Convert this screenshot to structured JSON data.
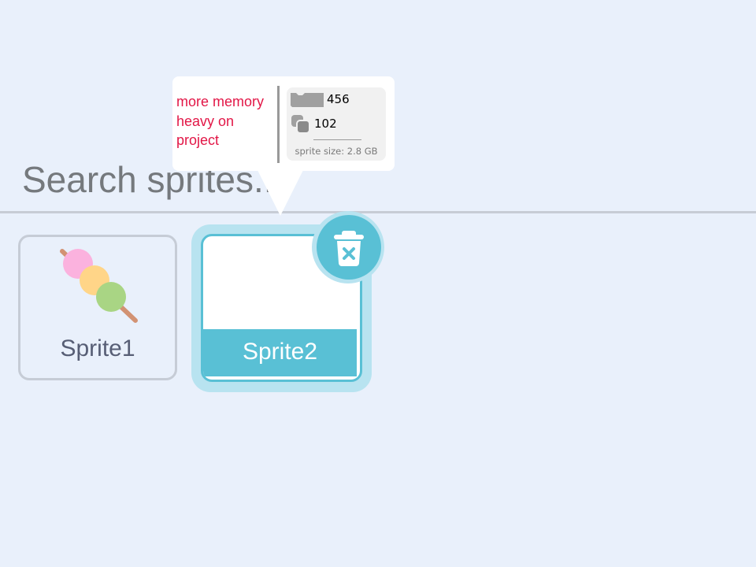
{
  "search": {
    "placeholder": "Search sprites..."
  },
  "tooltip": {
    "note": "more memory heavy on project",
    "stats": {
      "blocks_icon": "block-icon",
      "blocks_count": "456",
      "costumes_icon": "costumes-icon",
      "costumes_count": "102",
      "sprite_size": "sprite size: 2.8 GB"
    }
  },
  "sprites": [
    {
      "name": "Sprite1",
      "icon": "dango-icon",
      "selected": false
    },
    {
      "name": "Sprite2",
      "selected": true
    }
  ],
  "delete_button": {
    "icon": "trash-icon"
  },
  "colors": {
    "background": "#e9f0fb",
    "accent": "#59c0d5",
    "accent_light": "#b8e3f0",
    "warning_text": "#e21646",
    "tile_border": "#c6ccd6",
    "sprite_label": "#575e75",
    "search_text": "#75797d"
  }
}
